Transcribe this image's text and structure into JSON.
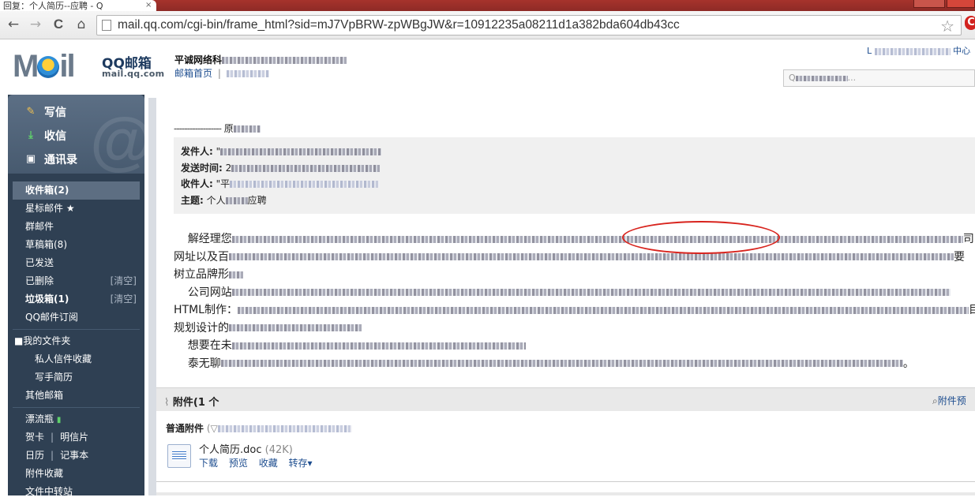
{
  "browser": {
    "tab_title": "回复：个人简历--应聘 - Q",
    "tab_close": "×",
    "url": "mail.qq.com/cgi-bin/frame_html?sid=mJ7VpBRW-zpWBgJW&r=10912235a08211d1a382bda604db43cc",
    "back_icon": "←",
    "forward_icon": "→",
    "reload_icon": "C",
    "home_icon": "⌂",
    "star_icon": "☆",
    "ext_label": "C"
  },
  "header": {
    "logo_m": "M",
    "logo_il": "il",
    "logo_text": "QQ邮箱",
    "logo_sub": "mail.qq.com",
    "user_name_prefix": "平诚网络科",
    "home_link": "邮箱首页",
    "divider": "|",
    "top_right_left": "L",
    "top_right_right": "中心",
    "search_placeholder": "Q",
    "search_suffix": "..."
  },
  "sidebar": {
    "compose": "写信",
    "receive": "收信",
    "contacts": "通讯录",
    "folders": [
      {
        "label": "收件箱(2)",
        "style": "active"
      },
      {
        "label": "星标邮件 ★",
        "style": ""
      },
      {
        "label": "群邮件",
        "style": ""
      },
      {
        "label": "草稿箱(8)",
        "style": ""
      },
      {
        "label": "已发送",
        "style": ""
      },
      {
        "label": "已删除",
        "style": "",
        "extra": "[清空]"
      },
      {
        "label": "垃圾箱(1)",
        "style": "bold",
        "extra": "[清空]"
      },
      {
        "label": "QQ邮件订阅",
        "style": ""
      }
    ],
    "my_folders": "■我的文件夹",
    "sub_folders": [
      "私人信件收藏",
      "写手简历"
    ],
    "other_mail": "其他邮箱",
    "bottle": "漂流瓶",
    "bottle_icon": "▮",
    "card": "贺卡",
    "postcard": "明信片",
    "calendar": "日历",
    "notebook": "记事本",
    "attach_fav": "附件收藏",
    "file_transfer": "文件中转站",
    "sep": "|"
  },
  "mail": {
    "orig_dash": "------------------",
    "orig_label": "原",
    "from_label": "发件人:",
    "from_value_start": "\"",
    "sent_label": "发送时间:",
    "sent_value_start": "2",
    "to_label": "收件人:",
    "to_value_start": "\"平",
    "subject_label": "主题:",
    "subject_value_start": "个人",
    "subject_value_end": "应聘",
    "para1_start": "解经理您",
    "para1_end": "司",
    "para2_start": "网址以及百",
    "para2_end": "要",
    "para3_start": "树立品牌形",
    "para4_start": "公司网站",
    "para5_start": "HTML制作：",
    "para5_end": "目",
    "para6_start": "规划设计的",
    "para7_start": "想要在未",
    "para8_start": "泰无聊",
    "para8_end": "。"
  },
  "attachments": {
    "title": "附件(1 个",
    "preview_link": "附件预",
    "normal_label": "普通附件",
    "normal_paren": "(",
    "file_name": "个人简历.doc",
    "file_size": "(42K)",
    "actions": [
      "下载",
      "预览",
      "收藏",
      "转存▾"
    ]
  }
}
